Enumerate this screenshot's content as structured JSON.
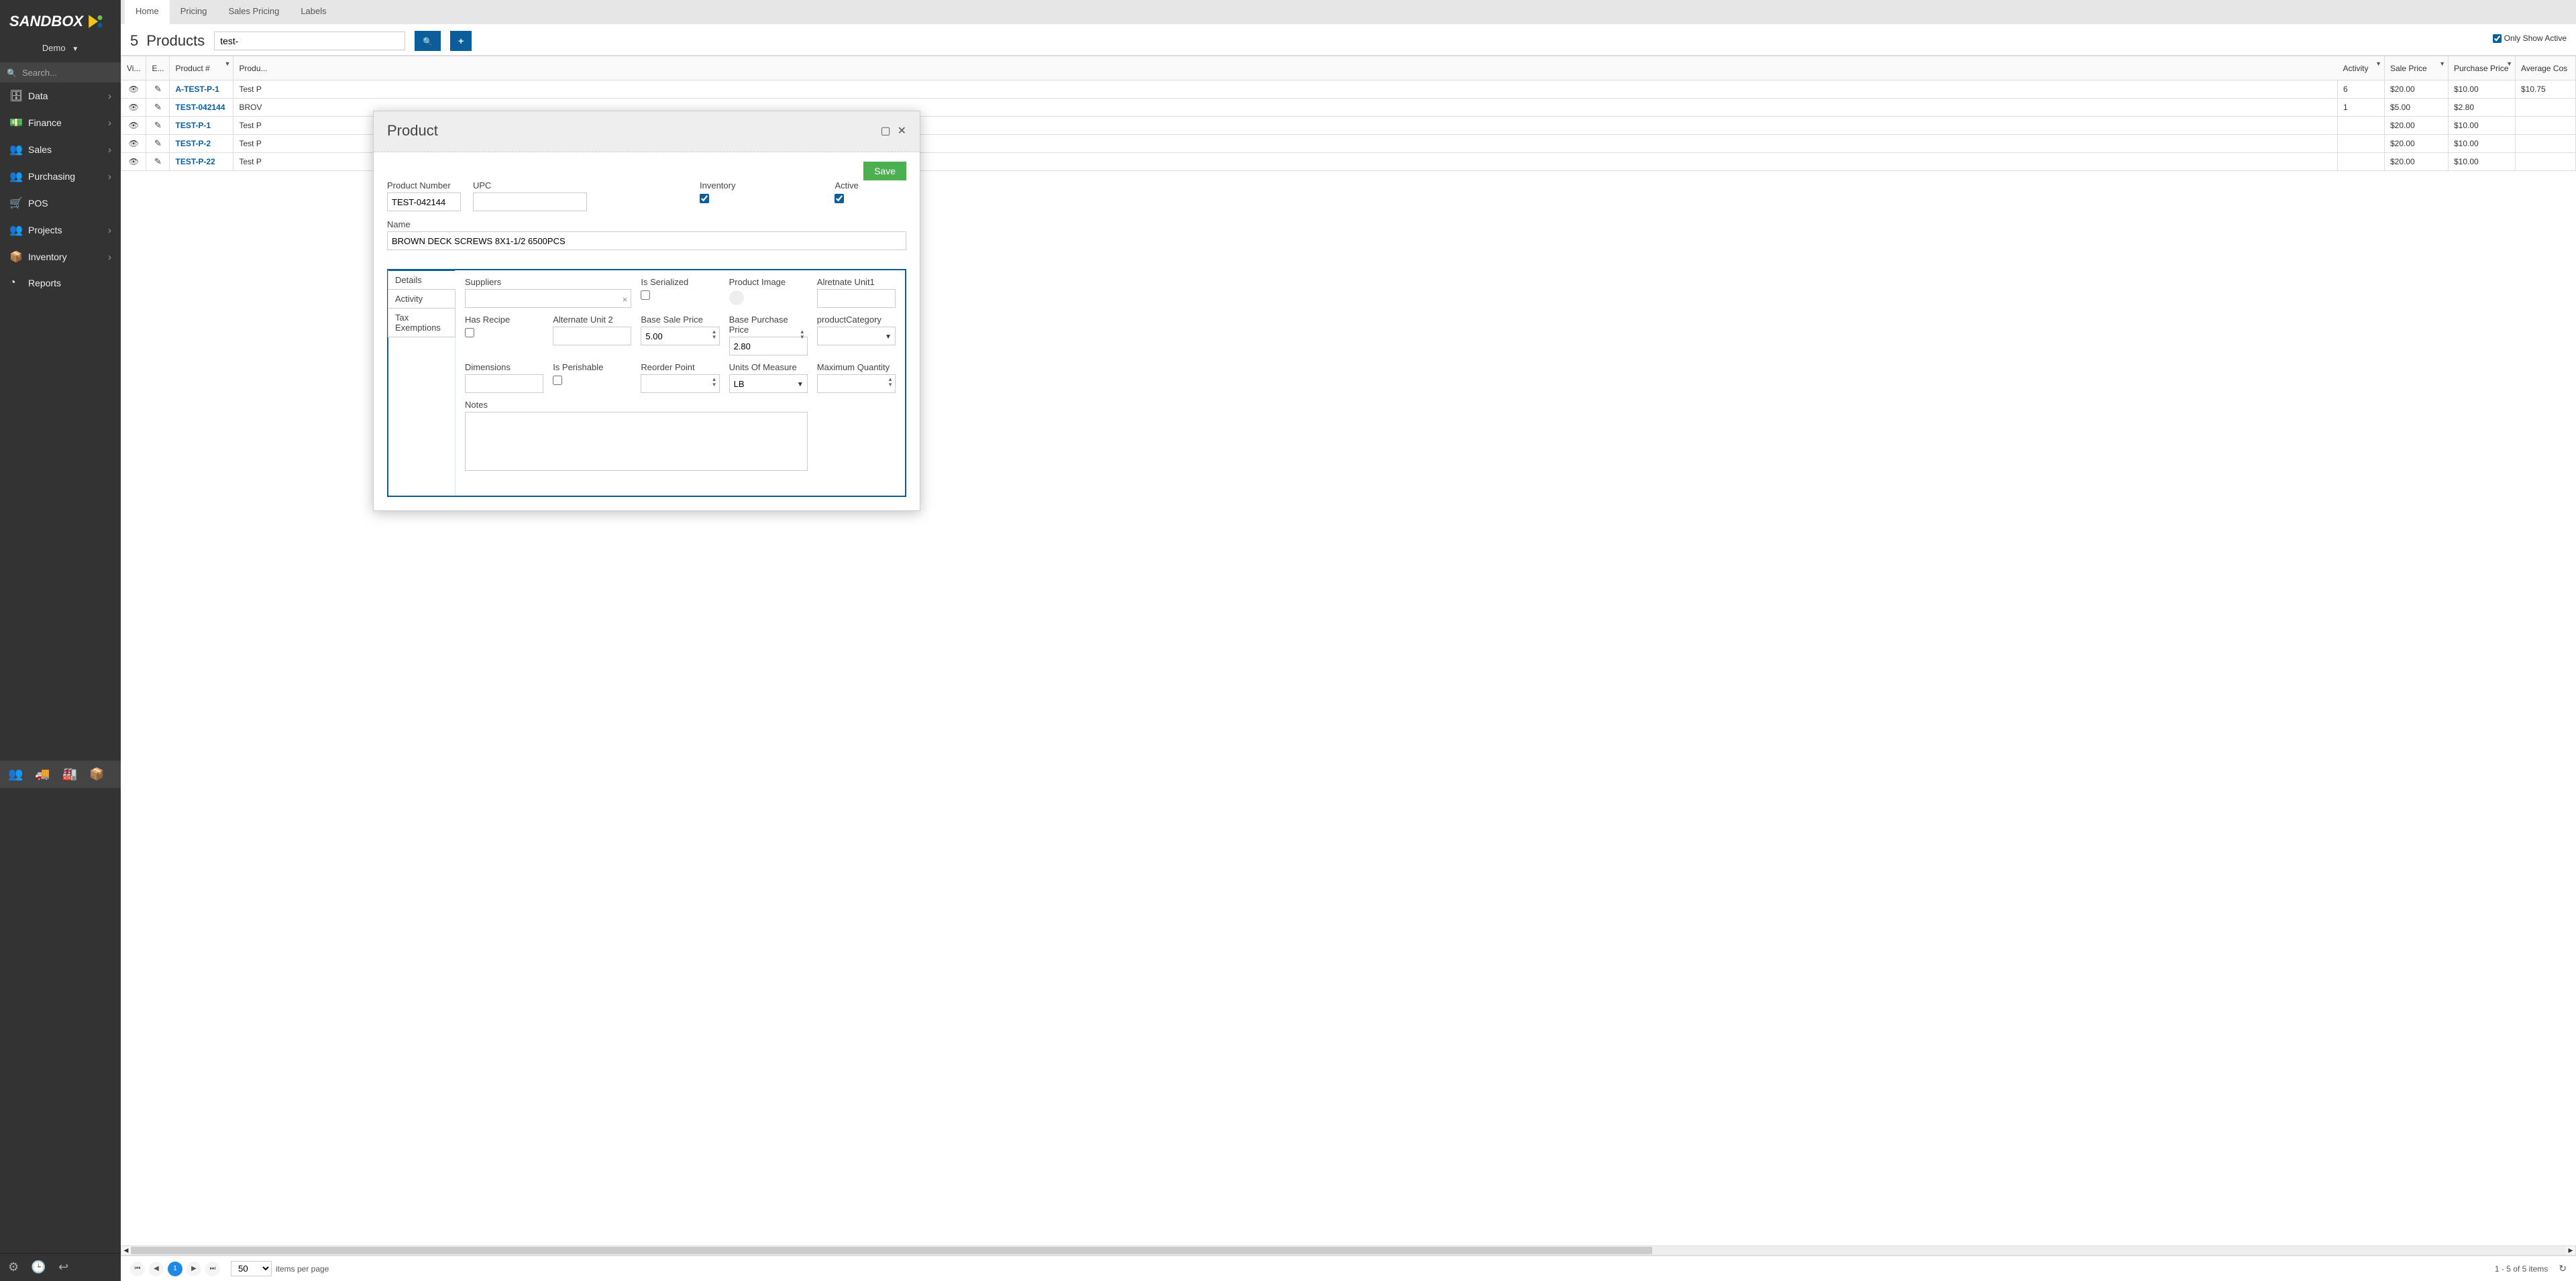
{
  "brand": "SANDBOX",
  "org": "Demo",
  "sidebar_search_placeholder": "Search...",
  "nav": [
    {
      "icon": "i-database",
      "label": "Data",
      "expandable": true
    },
    {
      "icon": "i-money",
      "label": "Finance",
      "expandable": true
    },
    {
      "icon": "i-users",
      "label": "Sales",
      "expandable": true
    },
    {
      "icon": "i-users",
      "label": "Purchasing",
      "expandable": true
    },
    {
      "icon": "i-cart",
      "label": "POS",
      "expandable": false
    },
    {
      "icon": "i-users",
      "label": "Projects",
      "expandable": true
    },
    {
      "icon": "i-box",
      "label": "Inventory",
      "expandable": true
    },
    {
      "icon": "i-chart",
      "label": "Reports",
      "expandable": false
    }
  ],
  "tabs": [
    "Home",
    "Pricing",
    "Sales Pricing",
    "Labels"
  ],
  "active_tab": 0,
  "page_count": "5",
  "page_title": "Products",
  "search_value": "test-",
  "only_show_active_label": "Only Show Active",
  "only_show_active_checked": true,
  "columns": [
    "Vi...",
    "E...",
    "Product #",
    "Produ...",
    "Activity",
    "Sale Price",
    "Purchase Price",
    "Average Cos"
  ],
  "rows": [
    {
      "pnum": "A-TEST-P-1",
      "pname": "Test P",
      "activity": "6",
      "sale": "$20.00",
      "purchase": "$10.00",
      "avg": "$10.75"
    },
    {
      "pnum": "TEST-042144",
      "pname": "BROV",
      "activity": "1",
      "sale": "$5.00",
      "purchase": "$2.80",
      "avg": ""
    },
    {
      "pnum": "TEST-P-1",
      "pname": "Test P",
      "activity": "",
      "sale": "$20.00",
      "purchase": "$10.00",
      "avg": ""
    },
    {
      "pnum": "TEST-P-2",
      "pname": "Test P",
      "activity": "",
      "sale": "$20.00",
      "purchase": "$10.00",
      "avg": ""
    },
    {
      "pnum": "TEST-P-22",
      "pname": "Test P",
      "activity": "",
      "sale": "$20.00",
      "purchase": "$10.00",
      "avg": ""
    }
  ],
  "modal": {
    "title": "Product",
    "save_label": "Save",
    "labels": {
      "product_number": "Product Number",
      "upc": "UPC",
      "inventory": "Inventory",
      "active": "Active",
      "name": "Name",
      "suppliers": "Suppliers",
      "is_serialized": "Is Serialized",
      "product_image": "Product Image",
      "alt_unit1": "Alretnate Unit1",
      "has_recipe": "Has Recipe",
      "alt_unit2": "Alternate Unit 2",
      "base_sale": "Base Sale Price",
      "base_purchase": "Base Purchase Price",
      "category": "productCategory",
      "dimensions": "Dimensions",
      "perishable": "Is Perishable",
      "reorder": "Reorder Point",
      "uom": "Units Of Measure",
      "max_qty": "Maximum Quantity",
      "notes": "Notes"
    },
    "values": {
      "product_number": "TEST-042144",
      "upc": "",
      "inventory_checked": true,
      "active_checked": true,
      "name": "BROWN DECK SCREWS 8X1-1/2 6500PCS",
      "suppliers": "",
      "is_serialized_checked": false,
      "alt_unit1": "",
      "has_recipe_checked": false,
      "alt_unit2": "",
      "base_sale": "5.00",
      "base_purchase": "2.80",
      "category": "",
      "dimensions": "",
      "perishable_checked": false,
      "reorder": "",
      "uom": "LB",
      "max_qty": "",
      "notes": ""
    },
    "detail_tabs": [
      "Details",
      "Activity",
      "Tax Exemptions"
    ],
    "active_detail_tab": 0
  },
  "pager": {
    "page_size": "50",
    "per_page_label": "items per page",
    "summary": "1 - 5 of 5 items",
    "current_page": "1"
  }
}
